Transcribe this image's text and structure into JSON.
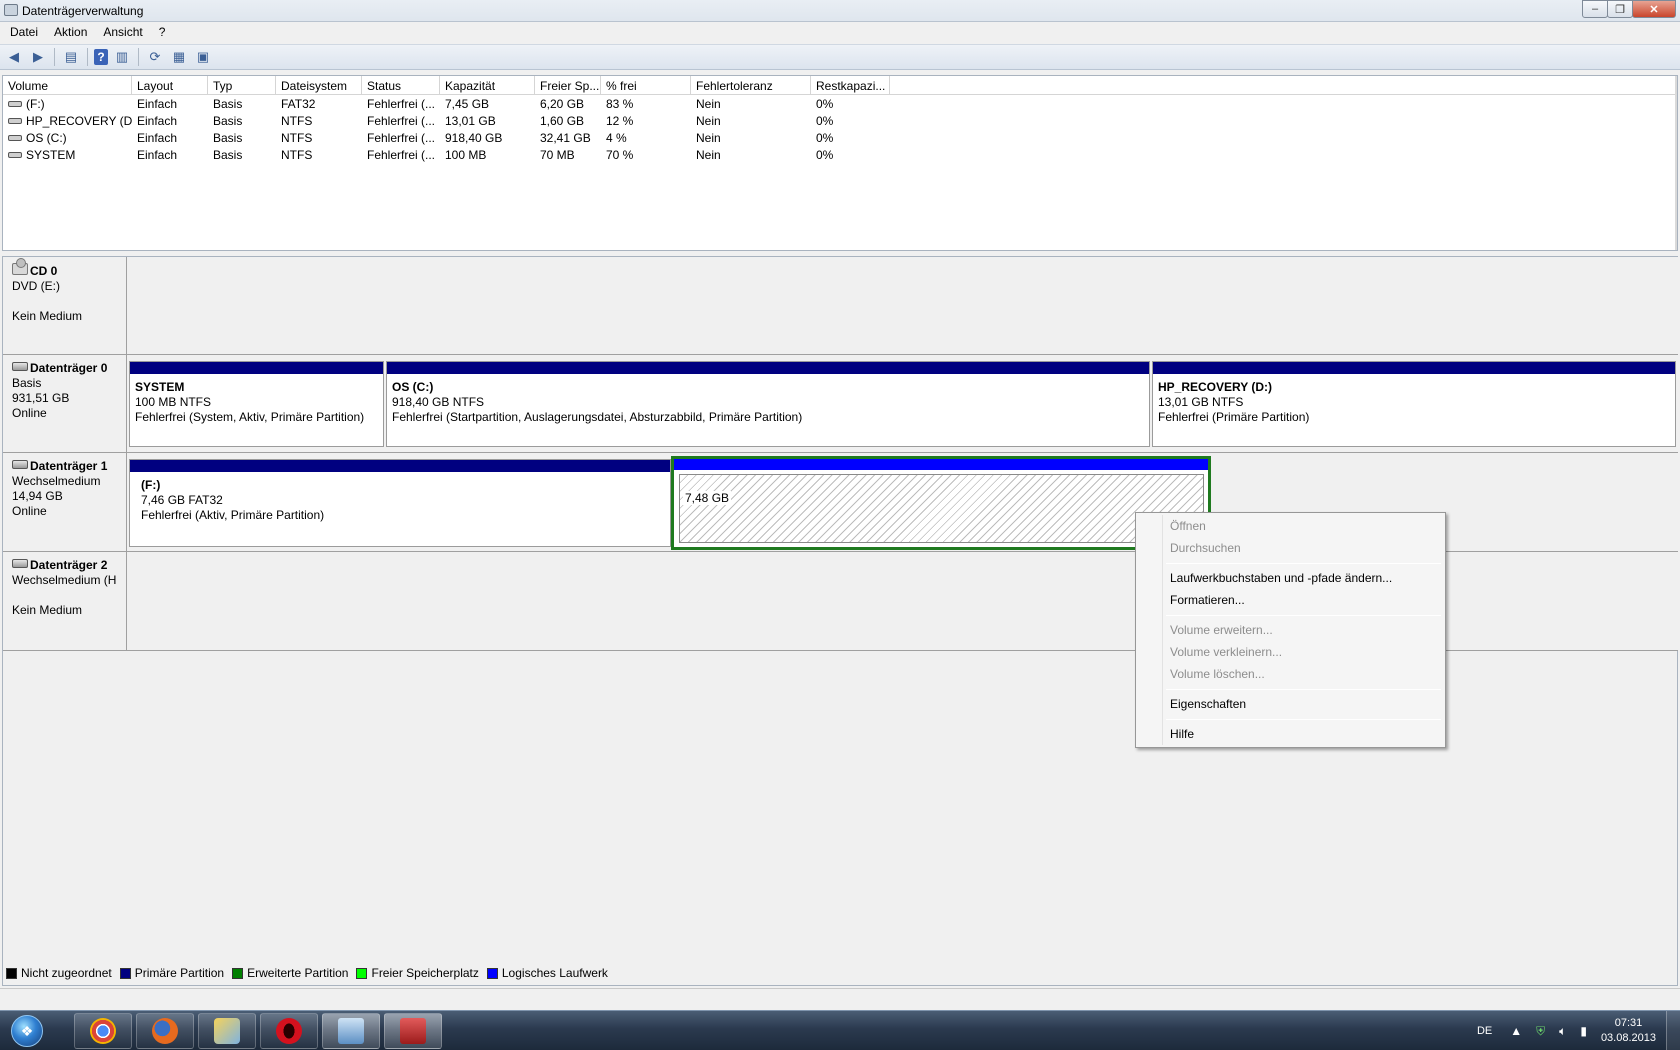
{
  "window": {
    "title": "Datenträgerverwaltung",
    "minimize": "‒",
    "maximize": "❐",
    "close": "✕"
  },
  "menu": {
    "items": [
      "Datei",
      "Aktion",
      "Ansicht",
      "?"
    ]
  },
  "volume_list": {
    "columns": [
      "Volume",
      "Layout",
      "Typ",
      "Dateisystem",
      "Status",
      "Kapazität",
      "Freier Sp...",
      "% frei",
      "Fehlertoleranz",
      "Restkapazi..."
    ],
    "rows": [
      [
        "(F:)",
        "Einfach",
        "Basis",
        "FAT32",
        "Fehlerfrei (...",
        "7,45 GB",
        "6,20 GB",
        "83 %",
        "Nein",
        "0%"
      ],
      [
        "HP_RECOVERY (D:)",
        "Einfach",
        "Basis",
        "NTFS",
        "Fehlerfrei (...",
        "13,01 GB",
        "1,60 GB",
        "12 %",
        "Nein",
        "0%"
      ],
      [
        "OS (C:)",
        "Einfach",
        "Basis",
        "NTFS",
        "Fehlerfrei (...",
        "918,40 GB",
        "32,41 GB",
        "4 %",
        "Nein",
        "0%"
      ],
      [
        "SYSTEM",
        "Einfach",
        "Basis",
        "NTFS",
        "Fehlerfrei (...",
        "100 MB",
        "70 MB",
        "70 %",
        "Nein",
        "0%"
      ]
    ]
  },
  "disks": {
    "cd0": {
      "name": "CD 0",
      "line1": "DVD (E:)",
      "line2": "",
      "line3": "Kein Medium"
    },
    "disk0": {
      "name": "Datenträger 0",
      "line1": "Basis",
      "line2": "931,51 GB",
      "line3": "Online",
      "partitions": [
        {
          "name": "SYSTEM",
          "size": "100 MB NTFS",
          "status": "Fehlerfrei (System, Aktiv, Primäre Partition)"
        },
        {
          "name": "OS  (C:)",
          "size": "918,40 GB NTFS",
          "status": "Fehlerfrei (Startpartition, Auslagerungsdatei, Absturzabbild, Primäre Partition)"
        },
        {
          "name": "HP_RECOVERY  (D:)",
          "size": "13,01 GB NTFS",
          "status": "Fehlerfrei (Primäre Partition)"
        }
      ]
    },
    "disk1": {
      "name": "Datenträger 1",
      "line1": "Wechselmedium",
      "line2": "14,94 GB",
      "line3": "Online",
      "partitions": [
        {
          "name": "(F:)",
          "size": "7,46 GB FAT32",
          "status": "Fehlerfrei (Aktiv, Primäre Partition)"
        },
        {
          "name": "",
          "size": "7,48 GB",
          "status": ""
        }
      ]
    },
    "disk2": {
      "name": "Datenträger 2",
      "line1": "Wechselmedium (H",
      "line2": "",
      "line3": "Kein Medium"
    }
  },
  "legend": [
    {
      "label": "Nicht zugeordnet",
      "color": "#000000"
    },
    {
      "label": "Primäre Partition",
      "color": "#000080"
    },
    {
      "label": "Erweiterte Partition",
      "color": "#007f00"
    },
    {
      "label": "Freier Speicherplatz",
      "color": "#00ff00"
    },
    {
      "label": "Logisches Laufwerk",
      "color": "#0000ff"
    }
  ],
  "context_menu": {
    "open": "Öffnen",
    "browse": "Durchsuchen",
    "change_letter": "Laufwerkbuchstaben und -pfade ändern...",
    "format": "Formatieren...",
    "extend": "Volume erweitern...",
    "shrink": "Volume verkleinern...",
    "delete": "Volume löschen...",
    "properties": "Eigenschaften",
    "help": "Hilfe"
  },
  "taskbar": {
    "language": "DE",
    "time": "07:31",
    "date": "03.08.2013"
  }
}
